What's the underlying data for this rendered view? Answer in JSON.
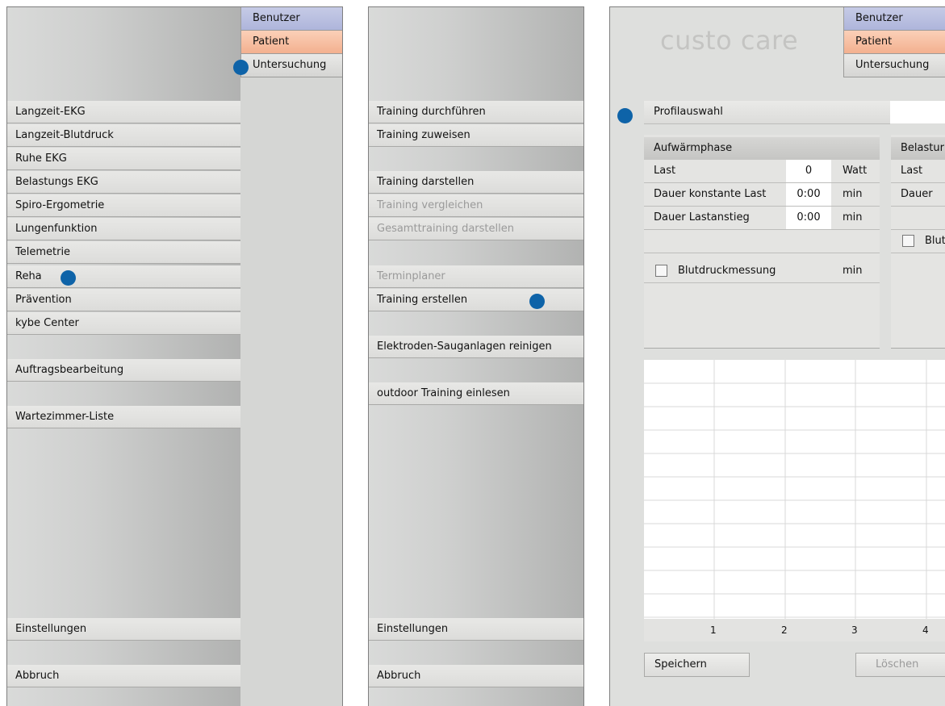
{
  "tabs": {
    "user": "Benutzer",
    "patient": "Patient",
    "exam": "Untersuchung"
  },
  "screen1": {
    "menu": [
      "Langzeit-EKG",
      "Langzeit-Blutdruck",
      "Ruhe EKG",
      "Belastungs EKG",
      "Spiro-Ergometrie",
      "Lungenfunktion",
      "Telemetrie",
      "Reha",
      "Prävention",
      "kybe Center"
    ],
    "orders": "Auftragsbearbeitung",
    "waiting": "Wartezimmer-Liste",
    "settings": "Einstellungen",
    "cancel": "Abbruch"
  },
  "screen2": {
    "menu": [
      "Training durchführen",
      "Training zuweisen",
      "Training darstellen",
      "Training vergleichen",
      "Gesamttraining darstellen",
      "Terminplaner",
      "Training erstellen",
      "Elektroden-Sauganlagen reinigen",
      "outdoor Training einlesen"
    ],
    "settings": "Einstellungen",
    "cancel": "Abbruch"
  },
  "screen3": {
    "logo": "custo care",
    "profile_label": "Profilauswahl",
    "warmup": {
      "header": "Aufwärmphase",
      "rows": [
        {
          "label": "Last",
          "value": "0",
          "unit": "Watt"
        },
        {
          "label": "Dauer konstante Last",
          "value": "0:00",
          "unit": "min"
        },
        {
          "label": "Dauer Lastanstieg",
          "value": "0:00",
          "unit": "min"
        }
      ],
      "bp_label": "Blutdruckmessung",
      "bp_unit": "min"
    },
    "load": {
      "header": "Belastur",
      "rows": [
        {
          "label": "Last"
        },
        {
          "label": "Dauer"
        }
      ],
      "bp_label": "Blut"
    },
    "chart_x_ticks": [
      "1",
      "2",
      "3",
      "4"
    ],
    "save": "Speichern",
    "delete": "Löschen"
  }
}
